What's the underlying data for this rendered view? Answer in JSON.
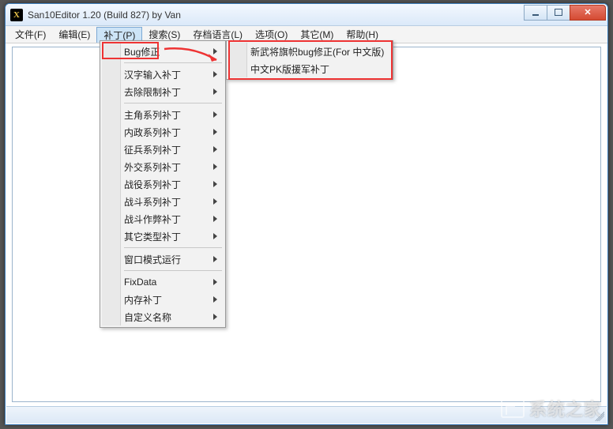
{
  "window": {
    "title": "San10Editor 1.20 (Build 827) by Van",
    "icon_letter": "X"
  },
  "menubar": {
    "items": [
      {
        "label": "文件(F)"
      },
      {
        "label": "编辑(E)"
      },
      {
        "label": "补丁(P)",
        "open": true
      },
      {
        "label": "搜索(S)"
      },
      {
        "label": "存档语言(L)"
      },
      {
        "label": "选项(O)"
      },
      {
        "label": "其它(M)"
      },
      {
        "label": "帮助(H)"
      }
    ]
  },
  "dropdown": {
    "groups": [
      [
        {
          "label": "Bug修正",
          "arrow": true
        }
      ],
      [
        {
          "label": "汉字输入补丁",
          "arrow": true
        },
        {
          "label": "去除限制补丁",
          "arrow": true
        }
      ],
      [
        {
          "label": "主角系列补丁",
          "arrow": true
        },
        {
          "label": "内政系列补丁",
          "arrow": true
        },
        {
          "label": "征兵系列补丁",
          "arrow": true
        },
        {
          "label": "外交系列补丁",
          "arrow": true
        },
        {
          "label": "战役系列补丁",
          "arrow": true
        },
        {
          "label": "战斗系列补丁",
          "arrow": true
        },
        {
          "label": "战斗作弊补丁",
          "arrow": true
        },
        {
          "label": "其它类型补丁",
          "arrow": true
        }
      ],
      [
        {
          "label": "窗口模式运行",
          "arrow": true
        }
      ],
      [
        {
          "label": "FixData",
          "arrow": true
        },
        {
          "label": "内存补丁",
          "arrow": true
        },
        {
          "label": "自定义名称",
          "arrow": true
        }
      ]
    ]
  },
  "submenu": {
    "items": [
      {
        "label": "新武将旗帜bug修正(For 中文版)"
      },
      {
        "label": "中文PK版援军补丁"
      }
    ]
  },
  "watermark": {
    "text": "系统之家"
  }
}
